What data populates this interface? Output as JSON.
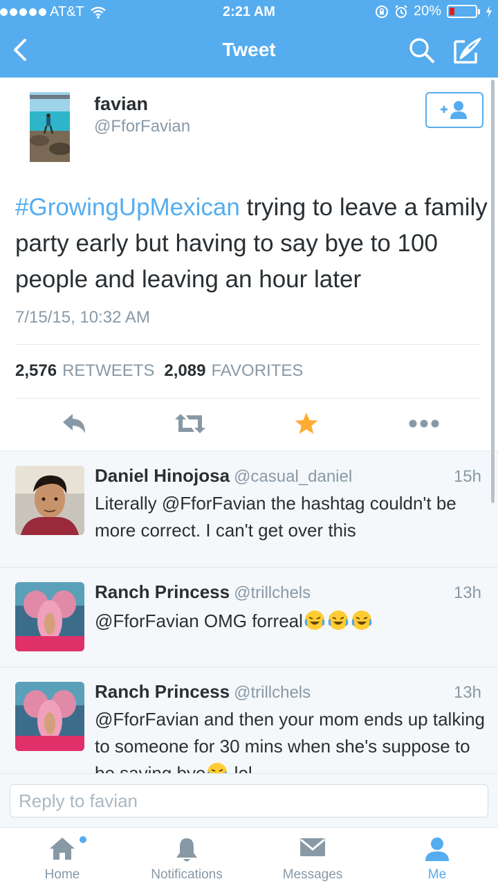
{
  "status_bar": {
    "carrier": "AT&T",
    "time": "2:21 AM",
    "battery_percent": "20%",
    "battery_level": 0.2
  },
  "nav": {
    "title": "Tweet",
    "back_icon": "chevron-left-icon",
    "search_icon": "search-icon",
    "compose_icon": "compose-icon"
  },
  "tweet": {
    "author_name": "favian",
    "author_handle": "@FforFavian",
    "hashtag": "#GrowingUpMexican",
    "text": " trying to leave a family party early but having to say bye to 100 people and leaving an hour later",
    "timestamp": "7/15/15, 10:32 AM",
    "retweets_count": "2,576",
    "retweets_label": "RETWEETS",
    "favorites_count": "2,089",
    "favorites_label": "FAVORITES"
  },
  "replies": [
    {
      "name": "Daniel Hinojosa",
      "handle": "@casual_daniel",
      "time": "15h",
      "text": "Literally @FforFavian the hashtag couldn't be more correct. I can't get over this"
    },
    {
      "name": "Ranch Princess",
      "handle": "@trillchels",
      "time": "13h",
      "text": "@FforFavian OMG forreal"
    },
    {
      "name": "Ranch Princess",
      "handle": "@trillchels",
      "time": "13h",
      "text": "@FforFavian and then your mom ends up talking to someone for 30 mins when she's suppose to be saying bye",
      "text_tail": " lol"
    }
  ],
  "reply_box": {
    "placeholder": "Reply to favian"
  },
  "tabs": [
    {
      "label": "Home",
      "icon": "home-icon"
    },
    {
      "label": "Notifications",
      "icon": "bell-icon"
    },
    {
      "label": "Messages",
      "icon": "envelope-icon"
    },
    {
      "label": "Me",
      "icon": "person-icon"
    }
  ],
  "colors": {
    "brand": "#55acee",
    "favorite": "#ffac33",
    "text": "#292f33",
    "muted": "#8899a6"
  }
}
